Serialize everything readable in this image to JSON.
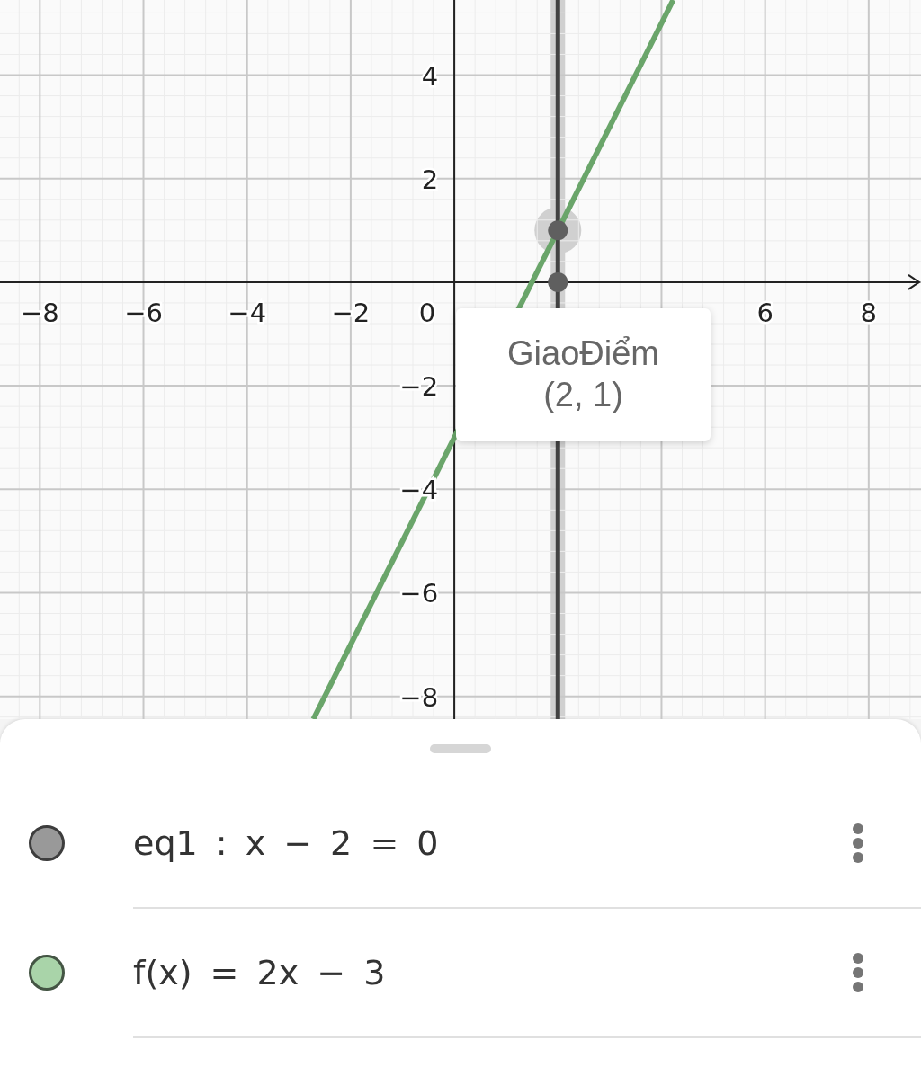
{
  "graph": {
    "chart_data": {
      "type": "line",
      "xlim": [
        -8.77,
        9.01
      ],
      "ylim": [
        -8.44,
        5.45
      ],
      "xticks": [
        {
          "value": -8,
          "label": "−8"
        },
        {
          "value": -6,
          "label": "−6"
        },
        {
          "value": -4,
          "label": "−4"
        },
        {
          "value": -2,
          "label": "−2"
        },
        {
          "value": 6,
          "label": "6"
        },
        {
          "value": 8,
          "label": "8"
        }
      ],
      "yticks": [
        {
          "value": 4,
          "label": "4"
        },
        {
          "value": 2,
          "label": "2"
        },
        {
          "value": -2,
          "label": "−2"
        },
        {
          "value": -4,
          "label": "−4"
        },
        {
          "value": -6,
          "label": "−6"
        },
        {
          "value": -8,
          "label": "−8"
        }
      ],
      "x": [
        -2.72,
        4.225,
        2
      ],
      "series": [
        {
          "color": "#6aa56a",
          "values": [
            -8.44,
            5.45,
            null
          ]
        },
        {
          "color": "#5f5f5f",
          "marker": "circle",
          "values": [
            null,
            null,
            1
          ]
        },
        {
          "color": "#5f5f5f",
          "marker": "circle",
          "values": [
            null,
            null,
            0
          ]
        }
      ],
      "ref_lines": [
        {
          "axis": "x",
          "value": 2,
          "color": "#424242"
        }
      ],
      "grid": true
    },
    "origin_label": "0",
    "tooltip": {
      "title": "GiaoĐiểm",
      "value": "(2, 1)"
    }
  },
  "algebra": [
    {
      "expression": "eq1 : x − 2 = 0",
      "color": "#999999"
    },
    {
      "expression": "f(x) = 2x − 3",
      "color": "#a9d4a9"
    }
  ]
}
